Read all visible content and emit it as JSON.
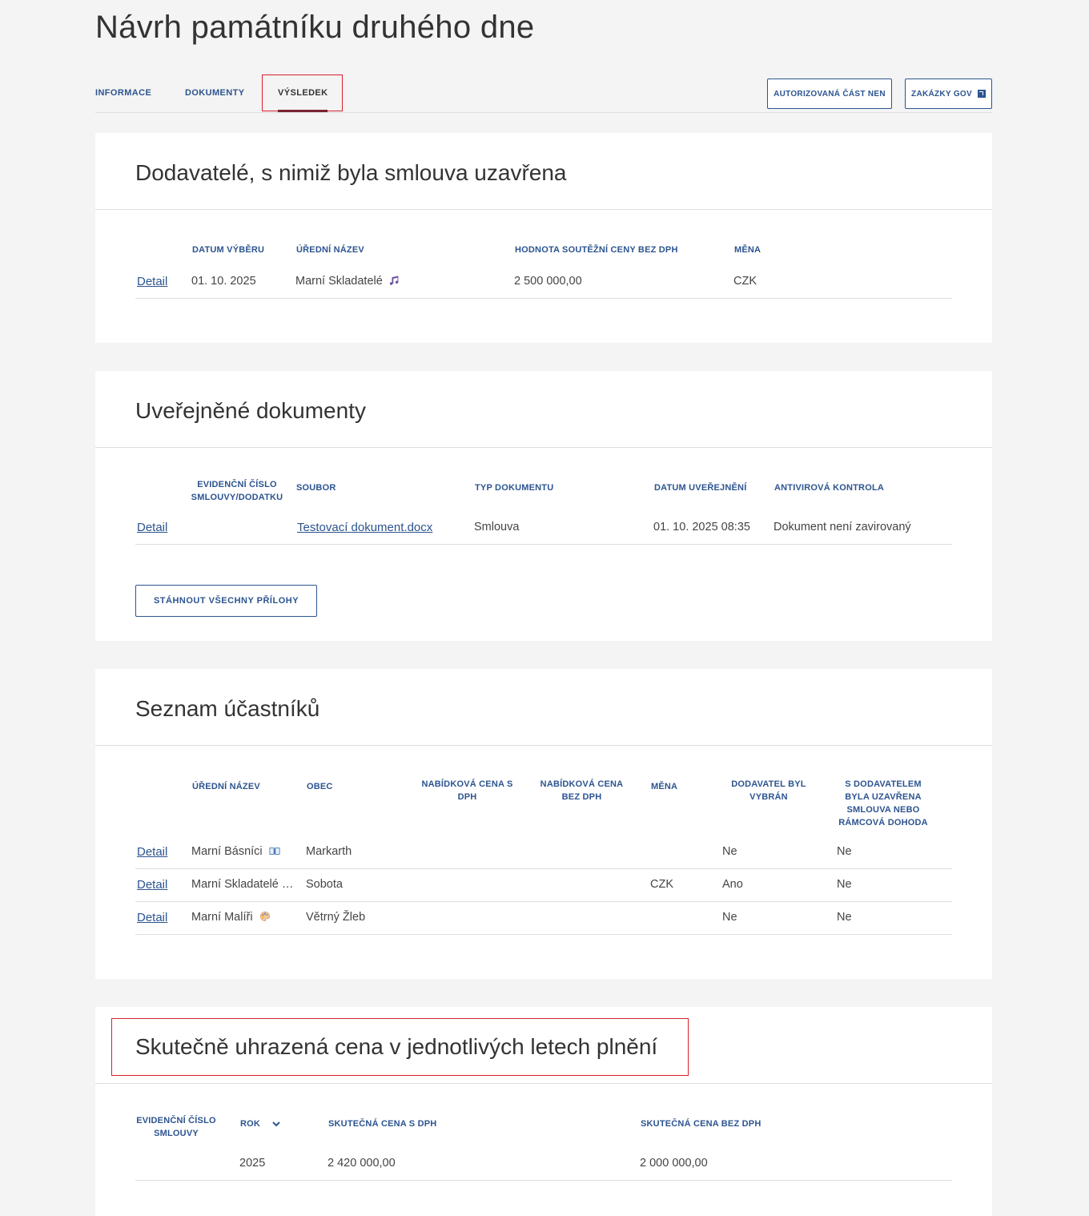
{
  "page": {
    "title": "Návrh památníku druhého dne"
  },
  "tabs": [
    {
      "label": "INFORMACE"
    },
    {
      "label": "DOKUMENTY"
    },
    {
      "label": "VÝSLEDEK"
    }
  ],
  "top_buttons": {
    "nen": "AUTORIZOVANÁ ČÁST NEN",
    "gov": "ZAKÁZKY GOV"
  },
  "suppliers": {
    "title": "Dodavatelé, s nimiž byla smlouva uzavřena",
    "headers": {
      "date": "DATUM VÝBĚRU",
      "name": "ÚŘEDNÍ NÁZEV",
      "value": "HODNOTA SOUTĚŽNÍ CENY BEZ DPH",
      "currency": "MĚNA"
    },
    "rows": [
      {
        "detail": "Detail",
        "date": "01. 10. 2025",
        "name": "Marní Skladatelé",
        "icon": "music-note-icon",
        "value": "2 500 000,00",
        "currency": "CZK"
      }
    ]
  },
  "documents": {
    "title": "Uveřejněné dokumenty",
    "headers": {
      "evid": "EVIDENČNÍ ČÍSLO SMLOUVY/DODATKU",
      "file": "SOUBOR",
      "type": "TYP DOKUMENTU",
      "date": "DATUM UVEŘEJNĚNÍ",
      "av": "ANTIVIROVÁ KONTROLA"
    },
    "rows": [
      {
        "detail": "Detail",
        "evid": "",
        "file": "Testovací dokument.docx",
        "type": "Smlouva",
        "date": "01. 10. 2025 08:35",
        "av": "Dokument není zavirovaný"
      }
    ],
    "download_all": "STÁHNOUT VŠECHNY PŘÍLOHY"
  },
  "participants": {
    "title": "Seznam účastníků",
    "headers": {
      "name": "ÚŘEDNÍ NÁZEV",
      "city": "OBEC",
      "price_vat": "NABÍDKOVÁ CENA S DPH",
      "price_novat": "NABÍDKOVÁ CENA BEZ DPH",
      "currency": "MĚNA",
      "selected": "DODAVATEL BYL VYBRÁN",
      "contract": "S DODAVATELEM BYLA UZAVŘENA SMLOUVA NEBO RÁMCOVÁ DOHODA"
    },
    "rows": [
      {
        "detail": "Detail",
        "name": "Marní Básníci",
        "icon": "book-icon",
        "city": "Markarth",
        "price_vat": "",
        "price_novat": "",
        "currency": "",
        "selected": "Ne",
        "contract": "Ne"
      },
      {
        "detail": "Detail",
        "name": "Marní Skladatelé …",
        "icon": "",
        "city": "Sobota",
        "price_vat": "",
        "price_novat": "",
        "currency": "CZK",
        "selected": "Ano",
        "contract": "Ne"
      },
      {
        "detail": "Detail",
        "name": "Marní Malíři",
        "icon": "palette-icon",
        "city": "Větrný Žleb",
        "price_vat": "",
        "price_novat": "",
        "currency": "",
        "selected": "Ne",
        "contract": "Ne"
      }
    ]
  },
  "actual_price": {
    "title": "Skutečně uhrazená cena v jednotlivých letech plnění",
    "headers": {
      "evid": "EVIDENČNÍ ČÍSLO SMLOUVY",
      "year": "ROK",
      "price_vat": "SKUTEČNÁ CENA S DPH",
      "price_novat": "SKUTEČNÁ CENA BEZ DPH"
    },
    "rows": [
      {
        "evid": "",
        "year": "2025",
        "price_vat": "2 420 000,00",
        "price_novat": "2 000 000,00"
      }
    ]
  },
  "colors": {
    "link": "#2c5490",
    "highlight": "#d81e2b",
    "tab_underline": "#7a2332",
    "background": "#f4f4f4"
  }
}
